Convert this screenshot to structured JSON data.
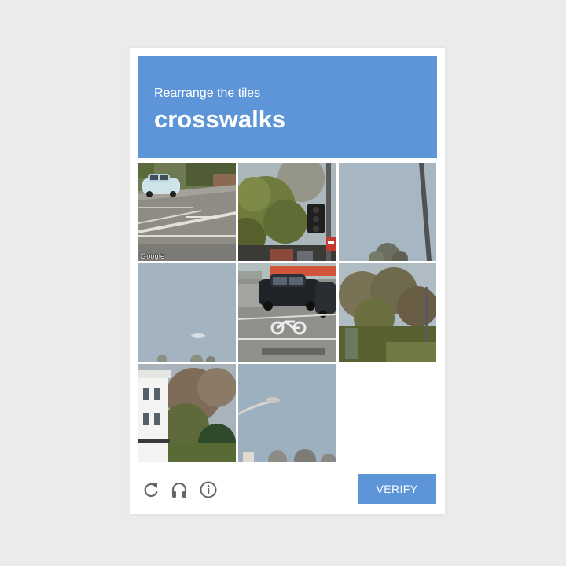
{
  "challenge": {
    "instruction": "Rearrange the tiles",
    "keyword": "crosswalks"
  },
  "tiles": [
    {
      "name": "tile-street-car",
      "scene": "street with parked white car and crosswalk markings",
      "watermark": "Google"
    },
    {
      "name": "tile-trees-signal",
      "scene": "trees with traffic signal pole"
    },
    {
      "name": "tile-sky-pole",
      "scene": "sky with lamp pole and treetop"
    },
    {
      "name": "tile-sky",
      "scene": "plain sky with small cloud"
    },
    {
      "name": "tile-cars-bike-lane",
      "scene": "dark cars on road with bicycle lane marking"
    },
    {
      "name": "tile-trees-right",
      "scene": "bare trees and hedge"
    },
    {
      "name": "tile-white-house",
      "scene": "white house with trees"
    },
    {
      "name": "tile-streetlight",
      "scene": "street light against sky"
    }
  ],
  "empty_slot": {
    "row": 3,
    "col": 3
  },
  "footer": {
    "reload_icon": "reload-icon",
    "audio_icon": "headphones-icon",
    "info_icon": "info-icon",
    "verify_label": "VERIFY"
  },
  "colors": {
    "accent": "#5d95d8",
    "page_background": "#ebebeb",
    "card_background": "#ffffff"
  }
}
